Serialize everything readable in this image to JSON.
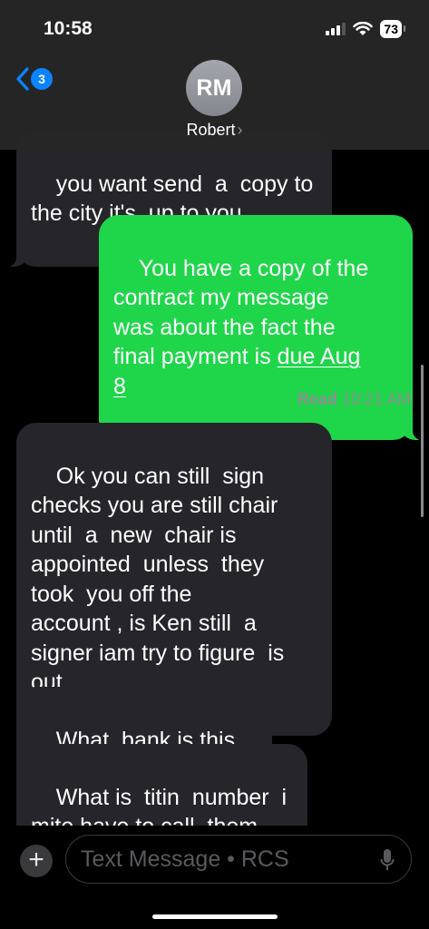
{
  "status_bar": {
    "time": "10:58",
    "battery": "73"
  },
  "header": {
    "back_badge": "3",
    "avatar_initials": "RM",
    "contact_name": "Robert",
    "chevron": "›"
  },
  "messages": [
    {
      "type": "received",
      "text": "you want send  a  copy to\nthe city it's  up to you"
    },
    {
      "type": "sent",
      "text_before": "You have a copy of the\ncontract my message\nwas about the fact the\nfinal payment is ",
      "link_text": "due Aug\n8"
    },
    {
      "type": "received",
      "text": "Ok you can still  sign\nchecks you are still chair\nuntil  a  new  chair is\nappointed  unless  they\ntook  you off the\naccount , is Ken still  a\nsigner iam try to figure  is\nout"
    },
    {
      "type": "received",
      "text": "What  bank is this in"
    },
    {
      "type": "received",
      "text": "What is  titin  number  i\nmite have to call  them"
    }
  ],
  "read_receipt": {
    "label": "Read",
    "time": "10:21 AM"
  },
  "composer": {
    "plus": "+",
    "placeholder": "Text Message • RCS"
  },
  "icons": {
    "back": "chevron-left-icon",
    "mic": "microphone-icon",
    "wifi": "wifi-icon",
    "signal": "cellular-signal-icon"
  },
  "colors": {
    "sent_bubble": "#1fd64a",
    "received_bubble": "#26252a",
    "accent": "#0a84ff"
  }
}
